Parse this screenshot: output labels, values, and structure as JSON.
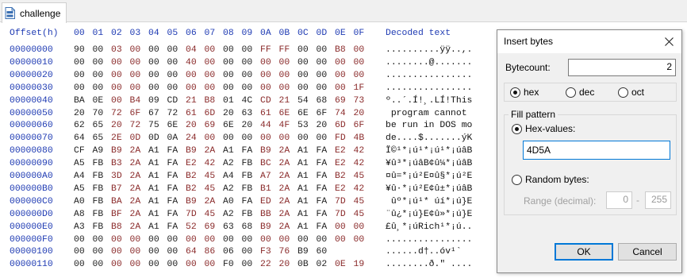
{
  "tab": {
    "label": "challenge"
  },
  "hex": {
    "header_offset": "Offset(h)",
    "header_cols": [
      "00",
      "01",
      "02",
      "03",
      "04",
      "05",
      "06",
      "07",
      "08",
      "09",
      "0A",
      "0B",
      "0C",
      "0D",
      "0E",
      "0F"
    ],
    "header_decoded": "Decoded text",
    "rows": [
      {
        "off": "00000000",
        "bytes": [
          "90",
          "00",
          "03",
          "00",
          "00",
          "00",
          "04",
          "00",
          "00",
          "00",
          "FF",
          "FF",
          "00",
          "00",
          "B8",
          "00"
        ],
        "text": "..........ÿÿ..,."
      },
      {
        "off": "00000010",
        "bytes": [
          "00",
          "00",
          "00",
          "00",
          "00",
          "00",
          "40",
          "00",
          "00",
          "00",
          "00",
          "00",
          "00",
          "00",
          "00",
          "00"
        ],
        "text": "........@......."
      },
      {
        "off": "00000020",
        "bytes": [
          "00",
          "00",
          "00",
          "00",
          "00",
          "00",
          "00",
          "00",
          "00",
          "00",
          "00",
          "00",
          "00",
          "00",
          "00",
          "00"
        ],
        "text": "................"
      },
      {
        "off": "00000030",
        "bytes": [
          "00",
          "00",
          "00",
          "00",
          "00",
          "00",
          "00",
          "00",
          "00",
          "00",
          "00",
          "00",
          "00",
          "00",
          "00",
          "1F"
        ],
        "text": "................"
      },
      {
        "off": "00000040",
        "bytes": [
          "BA",
          "0E",
          "00",
          "B4",
          "09",
          "CD",
          "21",
          "B8",
          "01",
          "4C",
          "CD",
          "21",
          "54",
          "68",
          "69",
          "73"
        ],
        "text": "º..´.Í!¸.LÍ!This"
      },
      {
        "off": "00000050",
        "bytes": [
          "20",
          "70",
          "72",
          "6F",
          "67",
          "72",
          "61",
          "6D",
          "20",
          "63",
          "61",
          "6E",
          "6E",
          "6F",
          "74",
          "20"
        ],
        "text": " program cannot "
      },
      {
        "off": "00000060",
        "bytes": [
          "62",
          "65",
          "20",
          "72",
          "75",
          "6E",
          "20",
          "69",
          "6E",
          "20",
          "44",
          "4F",
          "53",
          "20",
          "6D",
          "6F"
        ],
        "text": "be run in DOS mo"
      },
      {
        "off": "00000070",
        "bytes": [
          "64",
          "65",
          "2E",
          "0D",
          "0D",
          "0A",
          "24",
          "00",
          "00",
          "00",
          "00",
          "00",
          "00",
          "00",
          "FD",
          "4B"
        ],
        "text": "de....$.......ýK"
      },
      {
        "off": "00000080",
        "bytes": [
          "CF",
          "A9",
          "B9",
          "2A",
          "A1",
          "FA",
          "B9",
          "2A",
          "A1",
          "FA",
          "B9",
          "2A",
          "A1",
          "FA",
          "E2",
          "42"
        ],
        "text": "Ï©¹*¡ú¹*¡ú¹*¡úâB"
      },
      {
        "off": "00000090",
        "bytes": [
          "A5",
          "FB",
          "B3",
          "2A",
          "A1",
          "FA",
          "E2",
          "42",
          "A2",
          "FB",
          "BC",
          "2A",
          "A1",
          "FA",
          "E2",
          "42"
        ],
        "text": "¥û³*¡úâB¢û¼*¡úâB"
      },
      {
        "off": "000000A0",
        "bytes": [
          "A4",
          "FB",
          "3D",
          "2A",
          "A1",
          "FA",
          "B2",
          "45",
          "A4",
          "FB",
          "A7",
          "2A",
          "A1",
          "FA",
          "B2",
          "45"
        ],
        "text": "¤û=*¡ú²E¤û§*¡ú²E"
      },
      {
        "off": "000000B0",
        "bytes": [
          "A5",
          "FB",
          "B7",
          "2A",
          "A1",
          "FA",
          "B2",
          "45",
          "A2",
          "FB",
          "B1",
          "2A",
          "A1",
          "FA",
          "E2",
          "42"
        ],
        "text": "¥û·*¡ú²E¢û±*¡úâB"
      },
      {
        "off": "000000C0",
        "bytes": [
          "A0",
          "FB",
          "BA",
          "2A",
          "A1",
          "FA",
          "B9",
          "2A",
          "A0",
          "FA",
          "ED",
          "2A",
          "A1",
          "FA",
          "7D",
          "45"
        ],
        "text": " ûº*¡ú¹* úí*¡ú}E"
      },
      {
        "off": "000000D0",
        "bytes": [
          "A8",
          "FB",
          "BF",
          "2A",
          "A1",
          "FA",
          "7D",
          "45",
          "A2",
          "FB",
          "BB",
          "2A",
          "A1",
          "FA",
          "7D",
          "45"
        ],
        "text": "¨û¿*¡ú}E¢û»*¡ú}E"
      },
      {
        "off": "000000E0",
        "bytes": [
          "A3",
          "FB",
          "B8",
          "2A",
          "A1",
          "FA",
          "52",
          "69",
          "63",
          "68",
          "B9",
          "2A",
          "A1",
          "FA",
          "00",
          "00"
        ],
        "text": "£û¸*¡úRich¹*¡ú.."
      },
      {
        "off": "000000F0",
        "bytes": [
          "00",
          "00",
          "00",
          "00",
          "00",
          "00",
          "00",
          "00",
          "00",
          "00",
          "00",
          "00",
          "00",
          "00",
          "00",
          "00"
        ],
        "text": "................"
      },
      {
        "off": "00000100",
        "bytes": [
          "00",
          "00",
          "00",
          "00",
          "00",
          "00",
          "64",
          "86",
          "06",
          "00",
          "F3",
          "76",
          "B9",
          "60"
        ],
        "text": "......d†..óv¹`"
      },
      {
        "off": "00000110",
        "bytes": [
          "00",
          "00",
          "00",
          "00",
          "00",
          "00",
          "00",
          "00",
          "F0",
          "00",
          "22",
          "20",
          "0B",
          "02",
          "0E",
          "19"
        ],
        "text": "........ð.\" ...."
      }
    ]
  },
  "dialog": {
    "title": "Insert bytes",
    "bytecount_label": "Bytecount:",
    "bytecount_value": "2",
    "radix": {
      "hex": "hex",
      "dec": "dec",
      "oct": "oct",
      "selected": "hex"
    },
    "fill_pattern_label": "Fill pattern",
    "hex_values_label": "Hex-values:",
    "hex_values_value": "4D5A",
    "random_bytes_label": "Random bytes:",
    "range_label": "Range (decimal):",
    "range_min": "0",
    "range_max": "255",
    "ok_label": "OK",
    "cancel_label": "Cancel",
    "colors": {
      "accent": "#0078d7",
      "offset_blue": "#1f3bb3",
      "byte_alt": "#8a2a2a"
    }
  }
}
